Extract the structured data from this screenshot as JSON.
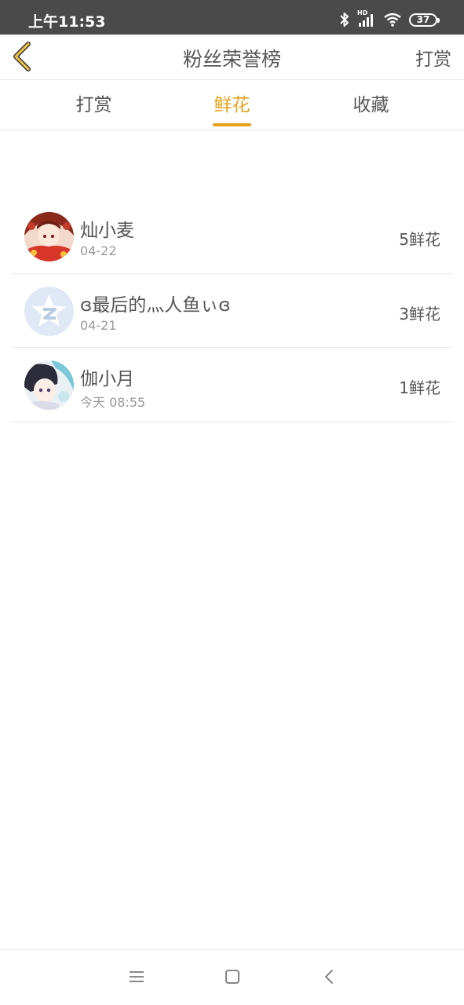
{
  "status_bar": {
    "time": "上午11:53",
    "battery": "37",
    "signal_label": "HD"
  },
  "header": {
    "title": "粉丝荣誉榜",
    "action_label": "打赏"
  },
  "tabs": [
    {
      "label": "打赏",
      "active": false
    },
    {
      "label": "鲜花",
      "active": true
    },
    {
      "label": "收藏",
      "active": false
    }
  ],
  "fans": [
    {
      "name": "灿小麦",
      "date": "04-22",
      "count": "5鲜花",
      "avatar": "anime-girl-avatar"
    },
    {
      "name": "ɞ最后的灬人鱼ぃɞ",
      "date": "04-21",
      "count": "3鲜花",
      "avatar": "default-star-avatar"
    },
    {
      "name": "伽小月",
      "date": "今天 08:55",
      "count": "1鲜花",
      "avatar": "anime-boy-avatar"
    }
  ],
  "colors": {
    "accent": "#e8a21a",
    "status_bar_bg": "#4a4a4a",
    "text_primary": "#555555",
    "text_secondary": "#999999",
    "divider": "#e8e8e8"
  },
  "icons": {
    "back": "chevron-left-icon",
    "bluetooth": "bluetooth-icon",
    "signal": "signal-icon",
    "wifi": "wifi-icon",
    "battery": "battery-icon",
    "nav_menu": "menu-icon",
    "nav_home": "home-square-icon",
    "nav_back": "back-triangle-icon"
  }
}
